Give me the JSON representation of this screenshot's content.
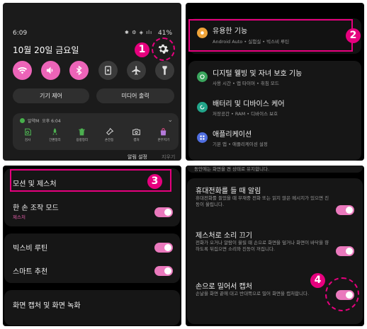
{
  "panel1": {
    "time": "6:09",
    "battery": "41%",
    "date": "10월 20일 금요일",
    "callout": "1",
    "device_control": "기기 제어",
    "media_output": "미디어 출력",
    "notification": {
      "app": "알약M",
      "time": "오후 6:04",
      "actions": [
        "검사",
        "간편정리",
        "용량정리",
        "손전등",
        "캡처",
        "몬무지기"
      ]
    },
    "notif_settings": "알림 설정",
    "clear": "지우기",
    "accent": "#ec64b8"
  },
  "panel2": {
    "callout": "2",
    "items": [
      {
        "title": "유용한 기능",
        "sub": "Android Auto • 실험실 • 빅스비 루틴"
      },
      {
        "title": "디지털 웰빙 및 자녀 보호 기능",
        "sub": "사용 시간 • 앱 타이머 • 취침 모드"
      },
      {
        "title": "배터리 및 디바이스 케어",
        "sub": "저장공간 • RAM • 디바이스 보호"
      },
      {
        "title": "애플리케이션",
        "sub": "기본 앱 • 애플리케이션 설정"
      }
    ]
  },
  "panel3": {
    "callout": "3",
    "items": [
      {
        "title": "모션 및 제스처"
      },
      {
        "title": "한 손 조작 모드",
        "sub": "제스처"
      },
      {
        "title": "빅스비 루틴"
      },
      {
        "title": "스마트 추천"
      },
      {
        "title": "화면 캡처 및 화면 녹화"
      }
    ]
  },
  "panel4": {
    "callout": "4",
    "top_text": "동안에는 화면을 켠 상태로 유지합니다.",
    "items": [
      {
        "title": "휴대전화를 들 때 알림",
        "desc": "휴대전화를 들었을 때 부재중 전화 또는 읽지 않은 메시지가 있으면 진동이 울립니다."
      },
      {
        "title": "제스처로 소리 끄기",
        "desc": "전화가 오거나 알람이 울릴 때 손으로 화면을 덮거나 화면이 바닥을 향하도록 뒤집으면 소리와 진동이 꺼집니다."
      },
      {
        "title": "손으로 밀어서 캡처",
        "desc": "손날을 화면 끝에 대고 반대쪽으로 밀어 화면을 캡처합니다."
      }
    ]
  }
}
